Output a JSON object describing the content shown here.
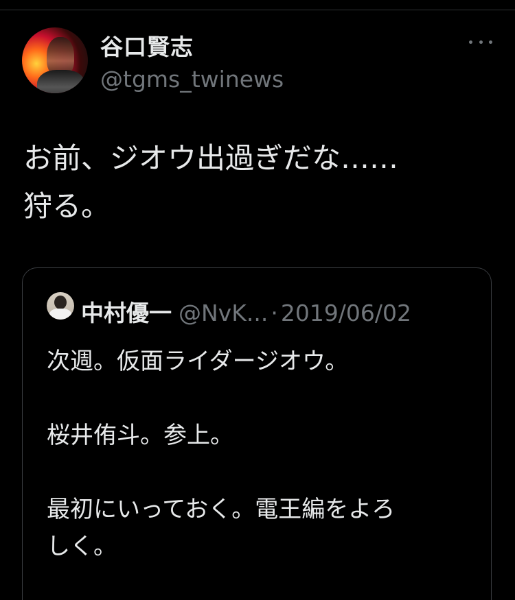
{
  "author": {
    "display_name": "谷口賢志",
    "handle": "@tgms_twinews"
  },
  "tweet": {
    "text": "お前、ジオウ出過ぎだな……\n狩る。"
  },
  "quoted_tweet": {
    "display_name": "中村優一",
    "handle": "@NvK...",
    "separator": "·",
    "date": "2019/06/02",
    "text": "次週。仮面ライダージオウ。\n\n桜井侑斗。参上。\n\n最初にいっておく。電王編をよろ\nしく。"
  },
  "icons": {
    "more": "more-horizontal-icon"
  },
  "colors": {
    "background": "#000000",
    "primary_text": "#e7e9ea",
    "secondary_text": "#71767b",
    "border": "#3a3d41"
  }
}
